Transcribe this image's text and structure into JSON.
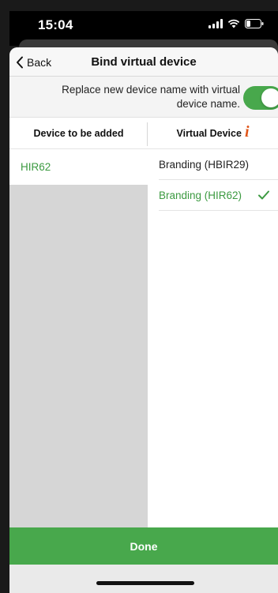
{
  "status_bar": {
    "time": "15:04"
  },
  "nav": {
    "back_label": "Back",
    "title": "Bind virtual device"
  },
  "toggle_row": {
    "text": "Replace new device name with virtual device name.",
    "enabled": true
  },
  "columns": {
    "left_header": "Device to be added",
    "right_header": "Virtual Device",
    "info_icon": "i"
  },
  "devices_to_add": [
    {
      "label": "HIR62"
    }
  ],
  "virtual_devices": [
    {
      "label": "Branding (HBIR29)",
      "selected": false
    },
    {
      "label": "Branding (HIR62)",
      "selected": true
    }
  ],
  "footer": {
    "done_label": "Done"
  },
  "colors": {
    "accent_green": "#48a84c",
    "info_orange": "#e0561a",
    "left_panel_grey": "#d6d6d6"
  }
}
